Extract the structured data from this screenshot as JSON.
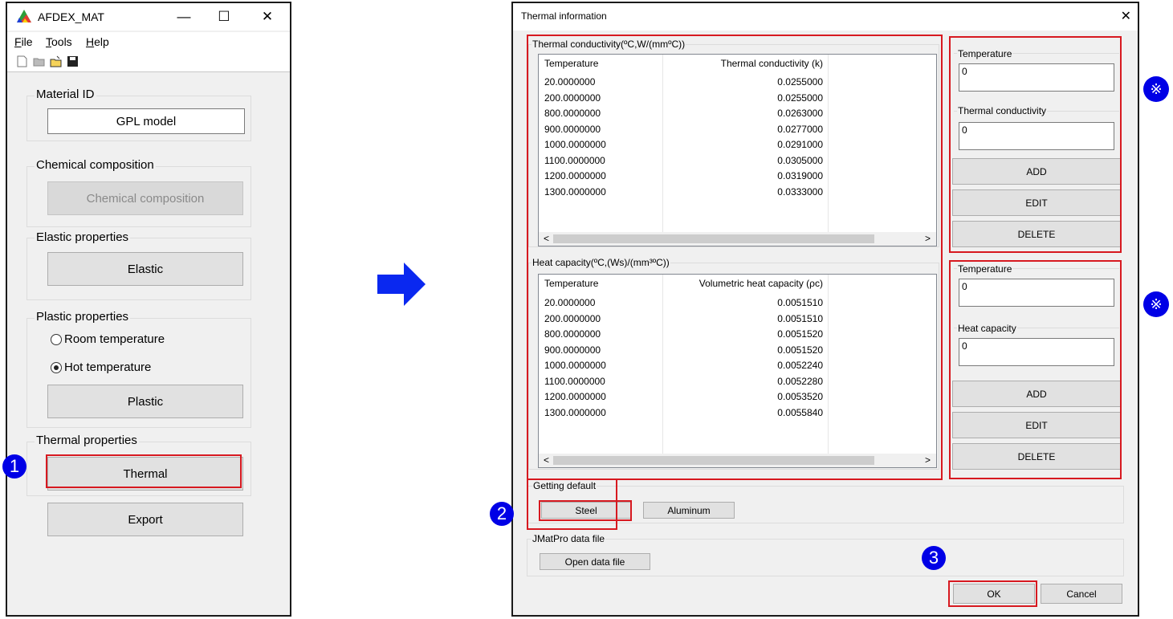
{
  "main_window": {
    "title": "AFDEX_MAT",
    "controls": {
      "minimize": "—",
      "maximize": "☐",
      "close": "✕"
    },
    "menu": [
      {
        "accel": "F",
        "rest": "ile"
      },
      {
        "accel": "T",
        "rest": "ools"
      },
      {
        "accel": "H",
        "rest": "elp"
      }
    ],
    "material_id": {
      "label": "Material ID",
      "value": "GPL model"
    },
    "chemical": {
      "label": "Chemical composition",
      "button": "Chemical composition"
    },
    "elastic": {
      "label": "Elastic properties",
      "button": "Elastic"
    },
    "plastic": {
      "label": "Plastic properties",
      "room": "Room temperature",
      "hot": "Hot temperature",
      "button": "Plastic"
    },
    "thermal": {
      "label": "Thermal properties",
      "button": "Thermal"
    },
    "export_button": "Export"
  },
  "dialog": {
    "title": "Thermal information",
    "close": "✕",
    "conductivity": {
      "label": "Thermal conductivity(ºC,W/(mmºC))",
      "headers": [
        "Temperature",
        "Thermal conductivity (k)"
      ],
      "rows": [
        [
          "20.0000000",
          "0.0255000"
        ],
        [
          "200.0000000",
          "0.0255000"
        ],
        [
          "800.0000000",
          "0.0263000"
        ],
        [
          "900.0000000",
          "0.0277000"
        ],
        [
          "1000.0000000",
          "0.0291000"
        ],
        [
          "1100.0000000",
          "0.0305000"
        ],
        [
          "1200.0000000",
          "0.0319000"
        ],
        [
          "1300.0000000",
          "0.0333000"
        ]
      ],
      "scroll_left": "<",
      "scroll_right": ">",
      "side": {
        "temp_label": "Temperature",
        "temp_value": "0",
        "value_label": "Thermal conductivity",
        "value_value": "0",
        "add": "ADD",
        "edit": "EDIT",
        "delete": "DELETE"
      }
    },
    "capacity": {
      "label": "Heat capacity(ºC,(Ws)/(mm³ºC))",
      "headers": [
        "Temperature",
        "Volumetric heat capacity (ρc)"
      ],
      "rows": [
        [
          "20.0000000",
          "0.0051510"
        ],
        [
          "200.0000000",
          "0.0051510"
        ],
        [
          "800.0000000",
          "0.0051520"
        ],
        [
          "900.0000000",
          "0.0051520"
        ],
        [
          "1000.0000000",
          "0.0052240"
        ],
        [
          "1100.0000000",
          "0.0052280"
        ],
        [
          "1200.0000000",
          "0.0053520"
        ],
        [
          "1300.0000000",
          "0.0055840"
        ]
      ],
      "scroll_left": "<",
      "scroll_right": ">",
      "side": {
        "temp_label": "Temperature",
        "temp_value": "0",
        "value_label": "Heat capacity",
        "value_value": "0",
        "add": "ADD",
        "edit": "EDIT",
        "delete": "DELETE"
      }
    },
    "default": {
      "label": "Getting default",
      "steel": "Steel",
      "aluminum": "Aluminum"
    },
    "jmatpro": {
      "label": "JMatPro data file",
      "button": "Open data file"
    },
    "ok": "OK",
    "cancel": "Cancel"
  },
  "annotations": {
    "step1": "1",
    "step2": "2",
    "step3": "3",
    "note_symbol": "※",
    "colors": {
      "badge": "#0000e6",
      "highlight": "#d71920",
      "arrow": "#0a28f0"
    }
  }
}
